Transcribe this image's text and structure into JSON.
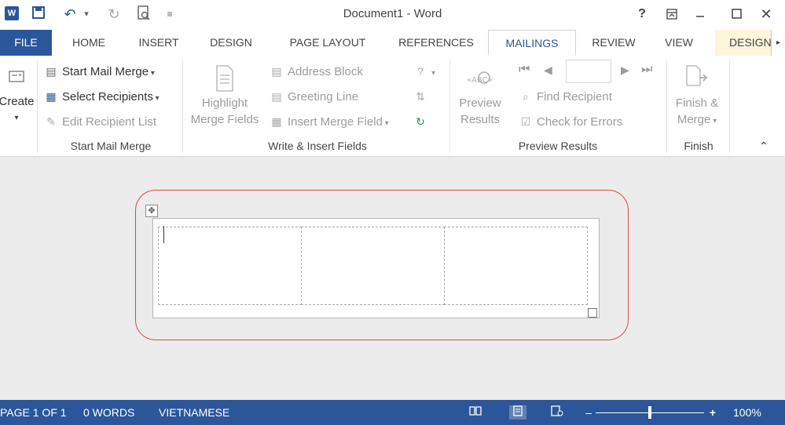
{
  "window": {
    "title": "Document1 - Word"
  },
  "qat": {
    "word_logo": "W",
    "save_icon": "save-icon",
    "undo_icon": "undo-icon",
    "redo_icon": "redo-icon",
    "print_preview_icon": "print-preview-icon",
    "customize_icon": "customize-qat-icon"
  },
  "window_controls": {
    "help": "?",
    "ribbon_options": "ribbon-display-options-icon",
    "minimize": "minimize-icon",
    "maximize": "maximize-icon",
    "close": "close-icon"
  },
  "tabs": [
    {
      "label": "FILE"
    },
    {
      "label": "HOME"
    },
    {
      "label": "INSERT"
    },
    {
      "label": "DESIGN"
    },
    {
      "label": "PAGE LAYOUT"
    },
    {
      "label": "REFERENCES"
    },
    {
      "label": "MAILINGS"
    },
    {
      "label": "REVIEW"
    },
    {
      "label": "VIEW"
    },
    {
      "label": "DESIGN"
    }
  ],
  "ribbon": {
    "create": {
      "label": "Create"
    },
    "start_mail_merge": {
      "start_label": "Start Mail Merge",
      "select_label": "Select Recipients",
      "edit_label": "Edit Recipient List",
      "group_label": "Start Mail Merge"
    },
    "write_insert": {
      "highlight_label_1": "Highlight",
      "highlight_label_2": "Merge Fields",
      "address_label": "Address Block",
      "greeting_label": "Greeting Line",
      "insert_field_label": "Insert Merge Field",
      "group_label": "Write & Insert Fields"
    },
    "preview": {
      "preview_label_1": "Preview",
      "preview_label_2": "Results",
      "find_label": "Find Recipient",
      "check_label": "Check for Errors",
      "group_label": "Preview Results"
    },
    "finish": {
      "finish_label_1": "Finish &",
      "finish_label_2": "Merge",
      "group_label": "Finish"
    }
  },
  "status": {
    "page": "PAGE 1 OF 1",
    "words": "0 WORDS",
    "language": "VIETNAMESE",
    "zoom_level": "100%",
    "zoom_fraction": 0.5
  },
  "colors": {
    "brand": "#2b579a",
    "highlight_ring": "#d84a4a"
  }
}
